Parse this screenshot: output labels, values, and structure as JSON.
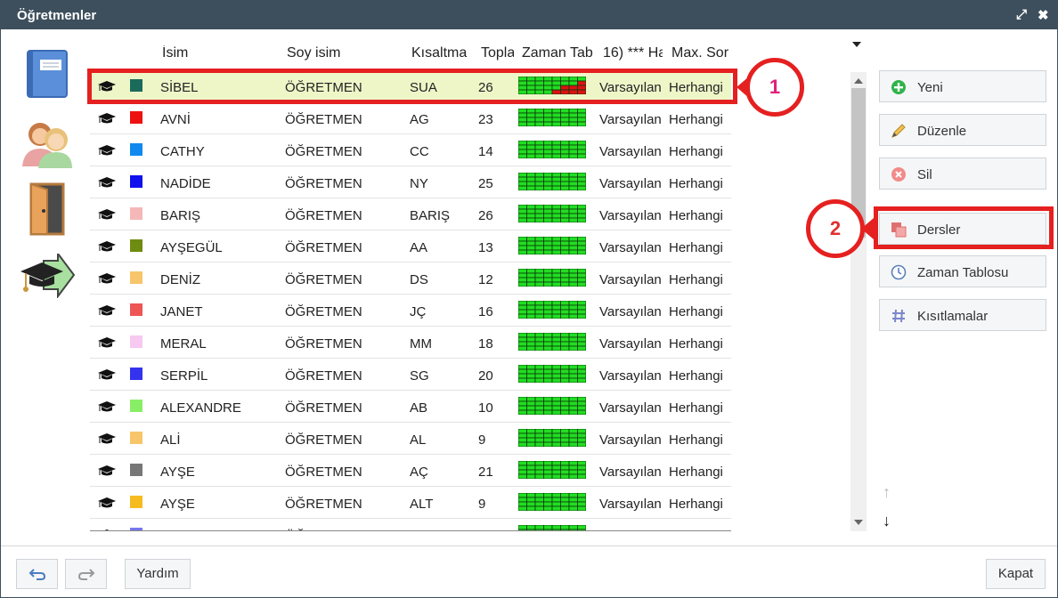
{
  "window": {
    "title": "Öğretmenler"
  },
  "columns": {
    "name": "İsim",
    "surname": "Soy isim",
    "short": "Kısaltma",
    "total": "Topla",
    "timetable": "Zaman Tab",
    "col16": "16) *** Ha",
    "max": "Max. Sor"
  },
  "rows": [
    {
      "name": "SİBEL",
      "surname": "ÖĞRETMEN",
      "short": "SUA",
      "total": "26",
      "col16": "Varsayılan",
      "max": "Herhangi",
      "color": "#1a6b5a",
      "selected": true
    },
    {
      "name": "AVNİ",
      "surname": "ÖĞRETMEN",
      "short": "AG",
      "total": "23",
      "col16": "Varsayılan",
      "max": "Herhangi",
      "color": "#ee1111"
    },
    {
      "name": "CATHY",
      "surname": "ÖĞRETMEN",
      "short": "CC",
      "total": "14",
      "col16": "Varsayılan",
      "max": "Herhangi",
      "color": "#1189ee"
    },
    {
      "name": "NADİDE",
      "surname": "ÖĞRETMEN",
      "short": "NY",
      "total": "25",
      "col16": "Varsayılan",
      "max": "Herhangi",
      "color": "#1111ee"
    },
    {
      "name": "BARIŞ",
      "surname": "ÖĞRETMEN",
      "short": "BARIŞ",
      "total": "26",
      "col16": "Varsayılan",
      "max": "Herhangi",
      "color": "#f5b8b8"
    },
    {
      "name": "AYŞEGÜL",
      "surname": "ÖĞRETMEN",
      "short": "AA",
      "total": "13",
      "col16": "Varsayılan",
      "max": "Herhangi",
      "color": "#6e8c11"
    },
    {
      "name": "DENİZ",
      "surname": "ÖĞRETMEN",
      "short": "DS",
      "total": "12",
      "col16": "Varsayılan",
      "max": "Herhangi",
      "color": "#f7c56a"
    },
    {
      "name": "JANET",
      "surname": "ÖĞRETMEN",
      "short": "JÇ",
      "total": "16",
      "col16": "Varsayılan",
      "max": "Herhangi",
      "color": "#ee5555"
    },
    {
      "name": "MERAL",
      "surname": "ÖĞRETMEN",
      "short": "MM",
      "total": "18",
      "col16": "Varsayılan",
      "max": "Herhangi",
      "color": "#f7c8f0"
    },
    {
      "name": "SERPİL",
      "surname": "ÖĞRETMEN",
      "short": "SG",
      "total": "20",
      "col16": "Varsayılan",
      "max": "Herhangi",
      "color": "#3333ee"
    },
    {
      "name": "ALEXANDRE",
      "surname": "ÖĞRETMEN",
      "short": "AB",
      "total": "10",
      "col16": "Varsayılan",
      "max": "Herhangi",
      "color": "#88ee66"
    },
    {
      "name": "ALİ",
      "surname": "ÖĞRETMEN",
      "short": "AL",
      "total": "9",
      "col16": "Varsayılan",
      "max": "Herhangi",
      "color": "#f7c56a"
    },
    {
      "name": "AYŞE",
      "surname": "ÖĞRETMEN",
      "short": "AÇ",
      "total": "21",
      "col16": "Varsayılan",
      "max": "Herhangi",
      "color": "#777777"
    },
    {
      "name": "AYŞE",
      "surname": "ÖĞRETMEN",
      "short": "ALT",
      "total": "9",
      "col16": "Varsayılan",
      "max": "Herhangi",
      "color": "#f7bb22"
    },
    {
      "name": "",
      "surname": "ÖĞRETMEN",
      "short": "",
      "total": "",
      "col16": "",
      "max": "",
      "color": "#7777ee"
    }
  ],
  "annotations": {
    "badge1": "1",
    "badge2": "2"
  },
  "actions": {
    "new": "Yeni",
    "edit": "Düzenle",
    "delete": "Sil",
    "lessons": "Dersler",
    "timetable": "Zaman Tablosu",
    "constraints": "Kısıtlamalar"
  },
  "move": {
    "up": "↑",
    "down": "↓"
  },
  "footer": {
    "help": "Yardım",
    "close": "Kapat"
  },
  "colors": {
    "title_bg": "#3d4f5c",
    "highlight": "#e52020",
    "selected_row": "#eef6c8",
    "timetable_green": "#22dd22",
    "timetable_red": "#dd1111"
  },
  "icons": [
    "graduation-cap-icon",
    "book-icon",
    "teachers-icon",
    "door-icon",
    "arrow-hat-icon",
    "plus-icon",
    "pencil-icon",
    "delete-icon",
    "lessons-icon",
    "clock-icon",
    "hash-icon",
    "undo-icon",
    "redo-icon",
    "maximize-icon",
    "close-icon"
  ]
}
